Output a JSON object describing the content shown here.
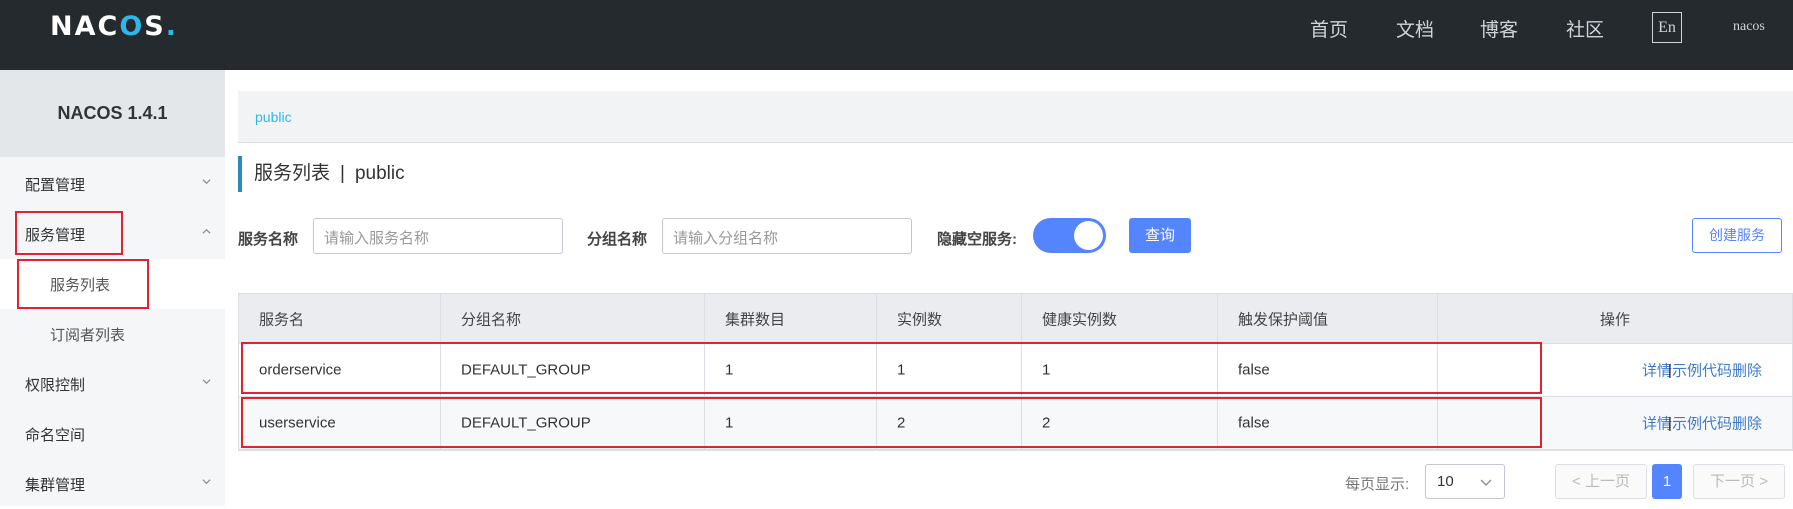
{
  "header": {
    "logo": "NACOS.",
    "nav": [
      "首页",
      "文档",
      "博客",
      "社区"
    ],
    "lang": "En",
    "user": "nacos"
  },
  "sidebar": {
    "title": "NACOS 1.4.1",
    "items": [
      {
        "label": "配置管理"
      },
      {
        "label": "服务管理"
      },
      {
        "label": "服务列表"
      },
      {
        "label": "订阅者列表"
      },
      {
        "label": "权限控制"
      },
      {
        "label": "命名空间"
      },
      {
        "label": "集群管理"
      }
    ]
  },
  "breadcrumb": {
    "namespace": "public"
  },
  "page": {
    "title": "服务列表",
    "separator": "|",
    "namespace": "public"
  },
  "filters": {
    "service_name_label": "服务名称",
    "service_name_placeholder": "请输入服务名称",
    "group_name_label": "分组名称",
    "group_name_placeholder": "请输入分组名称",
    "hide_empty_label": "隐藏空服务:",
    "hide_empty_on": true,
    "query_label": "查询",
    "create_label": "创建服务"
  },
  "table": {
    "columns": [
      "服务名",
      "分组名称",
      "集群数目",
      "实例数",
      "健康实例数",
      "触发保护阈值",
      "操作"
    ],
    "rows": [
      {
        "name": "orderservice",
        "group": "DEFAULT_GROUP",
        "clusters": "1",
        "instances": "1",
        "healthy": "1",
        "threshold": "false"
      },
      {
        "name": "userservice",
        "group": "DEFAULT_GROUP",
        "clusters": "1",
        "instances": "2",
        "healthy": "2",
        "threshold": "false"
      }
    ],
    "ops": {
      "detail": "详情",
      "sample": "示例代码",
      "delete": "删除",
      "sep": "|"
    }
  },
  "pagination": {
    "per_page_label": "每页显示:",
    "page_size": "10",
    "prev": "< 上一页",
    "current": "1",
    "next": "下一页 >"
  },
  "colors": {
    "accent": "#5584ff",
    "highlight": "#e0232e",
    "topbar": "#252a2f",
    "link": "#3e7bc9"
  }
}
